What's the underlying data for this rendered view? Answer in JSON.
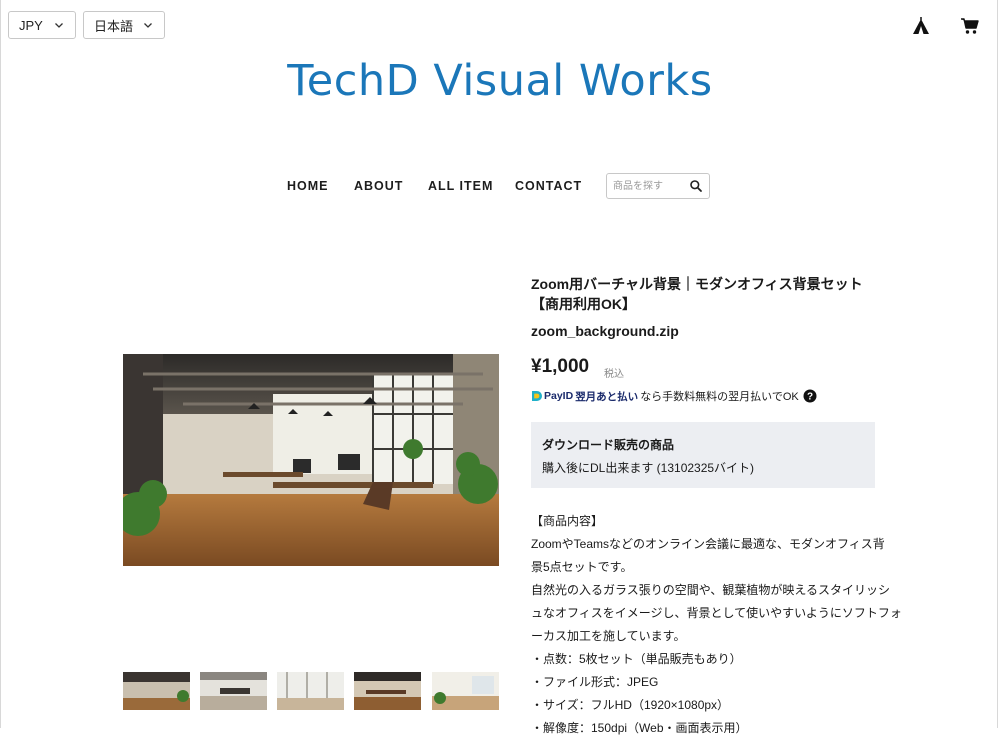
{
  "header": {
    "currency": "JPY",
    "language": "日本語",
    "brand_icon": "tent-icon",
    "cart_icon": "cart-icon"
  },
  "site": {
    "title": "TechD Visual Works"
  },
  "nav": {
    "items": [
      "HOME",
      "ABOUT",
      "ALL ITEM",
      "CONTACT"
    ],
    "search_placeholder": "商品を探す"
  },
  "product": {
    "title": "Zoom用バーチャル背景｜モダンオフィス背景セット【商用利用OK】",
    "filename": "zoom_background.zip",
    "price": "¥1,000",
    "tax_label": "税込",
    "payid": {
      "brand": "PayID",
      "label": "翌月あと払い",
      "text": "なら手数料無料の翌月払いでOK"
    },
    "download": {
      "heading": "ダウンロード販売の商品",
      "detail": "購入後にDL出来ます (13102325バイト)"
    },
    "description": [
      "【商品内容】",
      "ZoomやTeamsなどのオンライン会議に最適な、モダンオフィス背",
      "景5点セットです。",
      "自然光の入るガラス張りの空間や、観葉植物が映えるスタイリッシ",
      "ュなオフィスをイメージし、背景として使いやすいようにソフトフォ",
      "ーカス加工を施しています。",
      "・点数：5枚セット（単品販売もあり）",
      "・ファイル形式：JPEG",
      "・サイズ：フルHD（1920×1080px）",
      "・解像度：150dpi（Web・画面表示用）"
    ]
  },
  "colors": {
    "title_blue": "#1b77b9",
    "download_box_bg": "#eceef2",
    "payid_navy": "#1a2a6b"
  }
}
